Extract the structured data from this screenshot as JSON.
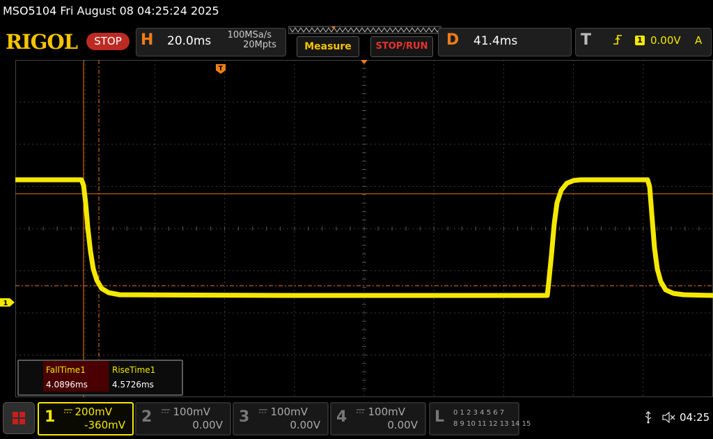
{
  "title_bar": {
    "text": "MSO5104  Fri August 08 04:25:24 2025"
  },
  "header": {
    "logo": "RIGOL",
    "run_state": "STOP",
    "horizontal": {
      "letter": "H",
      "timebase": "20.0ms",
      "sample_rate": "100MSa/s",
      "memory_depth": "20Mpts"
    },
    "measure_label": "Measure",
    "stop_run_label": "STOP/RUN",
    "delay": {
      "letter": "D",
      "value": "41.4ms"
    },
    "trigger": {
      "letter": "T",
      "edge_icon": "rising-edge-icon",
      "source": "1",
      "level": "0.00V",
      "mode": "A"
    }
  },
  "screen": {
    "ch1_marker_label": "1",
    "trigger_marker_label": "T"
  },
  "measurements": {
    "headers": [
      "FallTime1",
      "RiseTime1"
    ],
    "values": [
      "4.0896ms",
      "4.5726ms"
    ]
  },
  "channels": [
    {
      "num": "1",
      "scale": "200mV",
      "offset": "-360mV",
      "active": true
    },
    {
      "num": "2",
      "scale": "100mV",
      "offset": "0.00V",
      "active": false
    },
    {
      "num": "3",
      "scale": "100mV",
      "offset": "0.00V",
      "active": false
    },
    {
      "num": "4",
      "scale": "100mV",
      "offset": "0.00V",
      "active": false
    }
  ],
  "logic": {
    "letter": "L",
    "row1": "0 1 2 3   4 5 6 7",
    "row2": "8 9 10 11 12 13 14 15"
  },
  "status": {
    "time": "04:25"
  },
  "colors": {
    "ch1": "#f5e800",
    "accent_orange": "#f07c1a",
    "stop_red": "#bb2b24"
  }
}
